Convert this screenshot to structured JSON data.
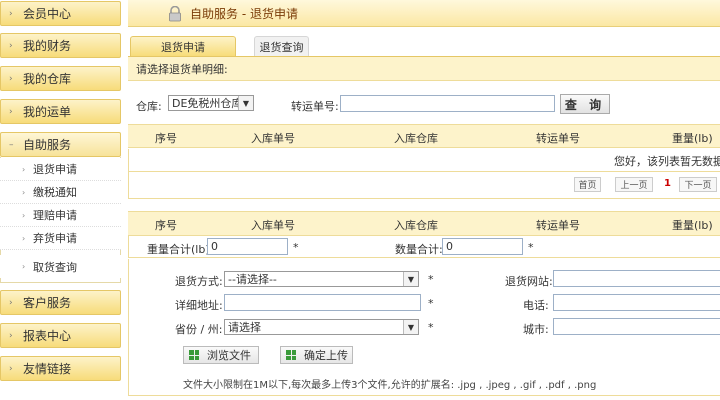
{
  "sidebar": {
    "menus": [
      {
        "label": "会员中心"
      },
      {
        "label": "我的财务"
      },
      {
        "label": "我的仓库"
      },
      {
        "label": "我的运单"
      },
      {
        "label": "自助服务"
      },
      {
        "label": "客户服务"
      },
      {
        "label": "报表中心"
      },
      {
        "label": "友情链接"
      }
    ],
    "sub_items": [
      {
        "label": "退货申请"
      },
      {
        "label": "缴税通知"
      },
      {
        "label": "理赔申请"
      },
      {
        "label": "弃货申请"
      },
      {
        "label": "取货查询"
      }
    ]
  },
  "header": {
    "title": "自助服务 - 退货申请"
  },
  "tabs": [
    {
      "label": "退货申请",
      "active": true
    },
    {
      "label": "退货查询",
      "active": false
    }
  ],
  "subtitle": "请选择退货单明细:",
  "filter": {
    "warehouse_label": "仓库:",
    "warehouse_value": "DE免税州仓库",
    "tracking_label": "转运单号:",
    "tracking_value": "",
    "query_button": "查 询"
  },
  "table1": {
    "headers": [
      "序号",
      "入库单号",
      "入库仓库",
      "转运单号",
      "重量(lb)"
    ],
    "empty_message": "您好，该列表暂无数据！",
    "pager": {
      "first": "首页",
      "prev": "上一页",
      "current": "1",
      "next": "下一页"
    }
  },
  "table2": {
    "headers": [
      "序号",
      "入库单号",
      "入库仓库",
      "转运单号",
      "重量(lb)"
    ],
    "weight_total_label": "重量合计(lb):",
    "weight_total_value": "0",
    "qty_total_label": "数量合计:",
    "qty_total_value": "0"
  },
  "form": {
    "return_method_label": "退货方式:",
    "return_method_value": "--请选择--",
    "return_site_label": "退货网站:",
    "address_label": "详细地址:",
    "phone_label": "电话:",
    "province_label": "省份 / 州:",
    "province_value": "请选择",
    "city_label": "城市:",
    "browse_button": "浏览文件",
    "upload_button": "确定上传",
    "note": "文件大小限制在1M以下,每次最多上传3个文件,允许的扩展名: .jpg , .jpeg , .gif , .pdf , .png"
  },
  "colors": {
    "accent": "#f7dc7a",
    "title_text": "#7a3b07",
    "page_current": "#cc0000"
  }
}
